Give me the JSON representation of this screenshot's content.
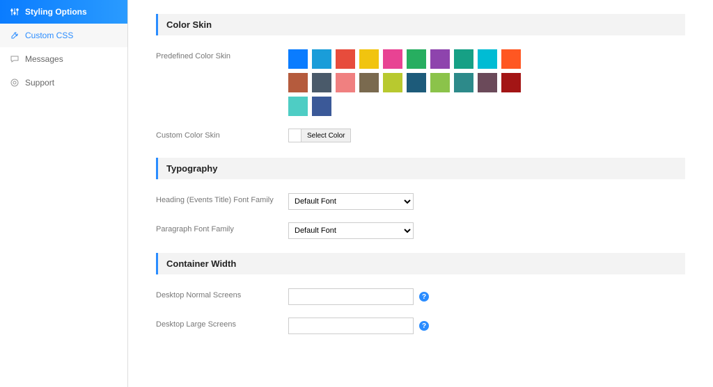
{
  "sidebar": {
    "items": [
      {
        "label": "Styling Options"
      },
      {
        "label": "Custom CSS"
      },
      {
        "label": "Messages"
      },
      {
        "label": "Support"
      }
    ]
  },
  "sections": {
    "color_skin": {
      "title": "Color Skin",
      "fields": {
        "predefined": "Predefined Color Skin",
        "custom": "Custom Color Skin",
        "select_color_btn": "Select Color"
      }
    },
    "typography": {
      "title": "Typography",
      "fields": {
        "heading_font": "Heading (Events Title) Font Family",
        "paragraph_font": "Paragraph Font Family"
      },
      "default_font_option": "Default Font"
    },
    "container_width": {
      "title": "Container Width",
      "fields": {
        "desktop_normal": "Desktop Normal Screens",
        "desktop_large": "Desktop Large Screens"
      }
    }
  },
  "swatches": [
    "#0a7cff",
    "#1a9dd9",
    "#e74c3c",
    "#f1c40f",
    "#e84393",
    "#27ae60",
    "#8e44ad",
    "#16a085",
    "#00bcd4",
    "#ff5722",
    "#b55b3d",
    "#4a5a6a",
    "#f08080",
    "#7a6a4f",
    "#b8c92f",
    "#1d5b7a",
    "#8bc34a",
    "#2d8a8a",
    "#6b4a5a",
    "#a31515",
    "#4ecdc4",
    "#3b5998"
  ]
}
